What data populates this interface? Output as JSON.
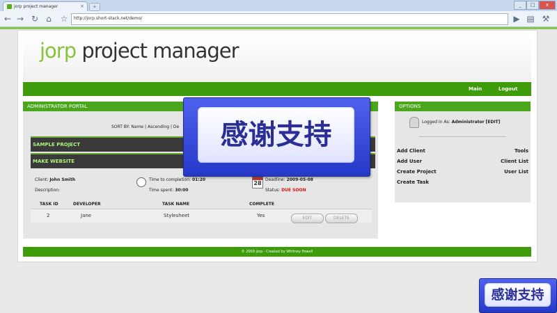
{
  "browser": {
    "tab_title": "jorp project manager",
    "tab_close": "×",
    "new_tab": "+",
    "url": "http://jorp.short-stack.net/demo/",
    "win_min": "_",
    "win_max": "□",
    "win_close": "x"
  },
  "logo": {
    "part1": "jorp",
    "part2": "project manager"
  },
  "nav": {
    "main": "Main",
    "logout": "Logout"
  },
  "left_panel": {
    "title": "ADMINISTRATOR PORTAL",
    "sort_by": "SORT BY: Name | Ascending | De",
    "project": "SAMPLE PROJECT",
    "task": "MAKE WEBSITE",
    "client_label": "Client:",
    "client_name": "John Smith",
    "description_label": "Description:",
    "time_to_completion_label": "Time to completion:",
    "time_to_completion": "01:20",
    "time_spent_label": "Time spent:",
    "time_spent": "30:00",
    "deadline_label": "Deadline:",
    "deadline": "2009-05-08",
    "status_label": "Status:",
    "status": "DUE SOON",
    "calendar_day": "28",
    "table": {
      "headers": [
        "TASK ID",
        "DEVELOPER",
        "TASK NAME",
        "COMPLETE"
      ],
      "rows": [
        [
          "2",
          "Jane",
          "Stylesheet",
          "Yes"
        ]
      ],
      "edit_label": "EDIT",
      "delete_label": "DELETE"
    }
  },
  "right_panel": {
    "title": "OPTIONS",
    "logged_in_label": "Logged In As:",
    "logged_in_user": "Administrator",
    "edit_link": "[EDIT]",
    "links_left": [
      "Add Client",
      "Add User",
      "Create Project",
      "Create Task"
    ],
    "links_right": [
      "Tools",
      "Client List",
      "User List"
    ]
  },
  "footer": "© 2009 jorp - Created by Whitney Powell",
  "overlay_text": "感谢支持",
  "colors": {
    "brand_green": "#3e9b0a",
    "accent_green": "#88c43a",
    "status_red": "#dd1111"
  }
}
